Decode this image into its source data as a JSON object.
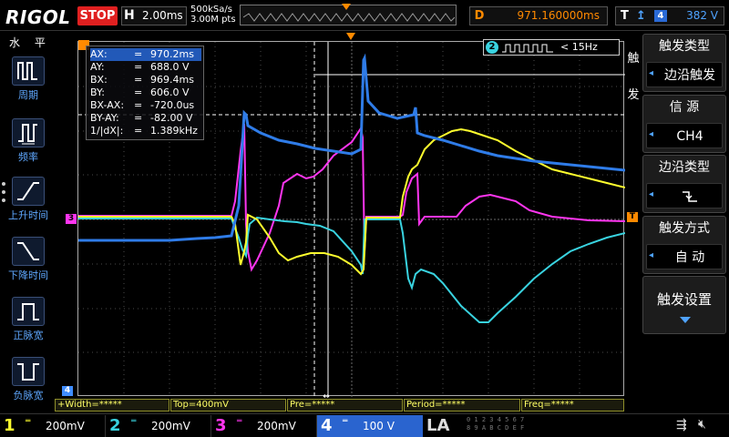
{
  "brand": {
    "logo": "RIGOL",
    "run_state": "STOP",
    "state_color": "#e02020"
  },
  "timebase": {
    "label": "H",
    "value": "2.00ms"
  },
  "acquisition": {
    "sample_rate": "500kSa/s",
    "mem_depth": "3.00M pts"
  },
  "delay": {
    "label": "D",
    "value": "971.160000ms"
  },
  "trigger_status": {
    "label": "T",
    "edge_icon": "rising-edge-icon",
    "source": "4",
    "level": "382 V"
  },
  "left_menu": {
    "title": "水 平",
    "items": [
      {
        "label": "周期",
        "icon": "period-icon"
      },
      {
        "label": "频率",
        "icon": "frequency-icon"
      },
      {
        "label": "上升时间",
        "icon": "rise-time-icon"
      },
      {
        "label": "下降时间",
        "icon": "fall-time-icon"
      },
      {
        "label": "正脉宽",
        "icon": "positive-width-icon"
      },
      {
        "label": "负脉宽",
        "icon": "negative-width-icon"
      }
    ]
  },
  "cursor_table": [
    {
      "key": "AX:",
      "eq": "=",
      "val": "970.2ms"
    },
    {
      "key": "AY:",
      "eq": "=",
      "val": "688.0 V"
    },
    {
      "key": "BX:",
      "eq": "=",
      "val": "969.4ms"
    },
    {
      "key": "BY:",
      "eq": "=",
      "val": "606.0 V"
    },
    {
      "key": "BX-AX:",
      "eq": "=",
      "val": "-720.0us"
    },
    {
      "key": "BY-AY:",
      "eq": "=",
      "val": "-82.00 V"
    },
    {
      "key": "1/|dX|:",
      "eq": "=",
      "val": "1.389kHz"
    }
  ],
  "ch2_freq_indicator": {
    "channel": "2",
    "text": "< 15Hz"
  },
  "channel_markers": {
    "ch3": "3",
    "ch4": "4",
    "trigger": "T",
    "ch1": "1"
  },
  "right_menu": {
    "side_title": [
      "触",
      "发"
    ],
    "trigger_type": {
      "title": "触发类型",
      "value": "边沿触发"
    },
    "source": {
      "title": "信 源",
      "value": "CH4"
    },
    "edge_type": {
      "title": "边沿类型",
      "icon": "falling-edge-select-icon"
    },
    "trigger_mode": {
      "title": "触发方式",
      "value": "自 动"
    },
    "settings": {
      "title": "触发设置"
    }
  },
  "measure_bar": [
    "+Width=*****",
    "Top=400mV",
    "Pre=*****",
    "Period=*****",
    "Freq=*****"
  ],
  "channels": [
    {
      "num": "1",
      "scale": "200mV",
      "color": "#ffff2e"
    },
    {
      "num": "2",
      "scale": "200mV",
      "color": "#39d3e0"
    },
    {
      "num": "3",
      "scale": "200mV",
      "color": "#ff35f0"
    },
    {
      "num": "4",
      "scale": "100 V",
      "color": "#3f8dff"
    }
  ],
  "logic": {
    "label": "LA",
    "digits": [
      "0 1 2 3  4 5 6 7",
      "8 9 A B  C D E F"
    ]
  },
  "colors": {
    "ch1": "#ffff2e",
    "ch2": "#39d3e0",
    "ch3": "#ff35f0",
    "ch4": "#2f7ce8",
    "accent": "#ff8a00"
  }
}
